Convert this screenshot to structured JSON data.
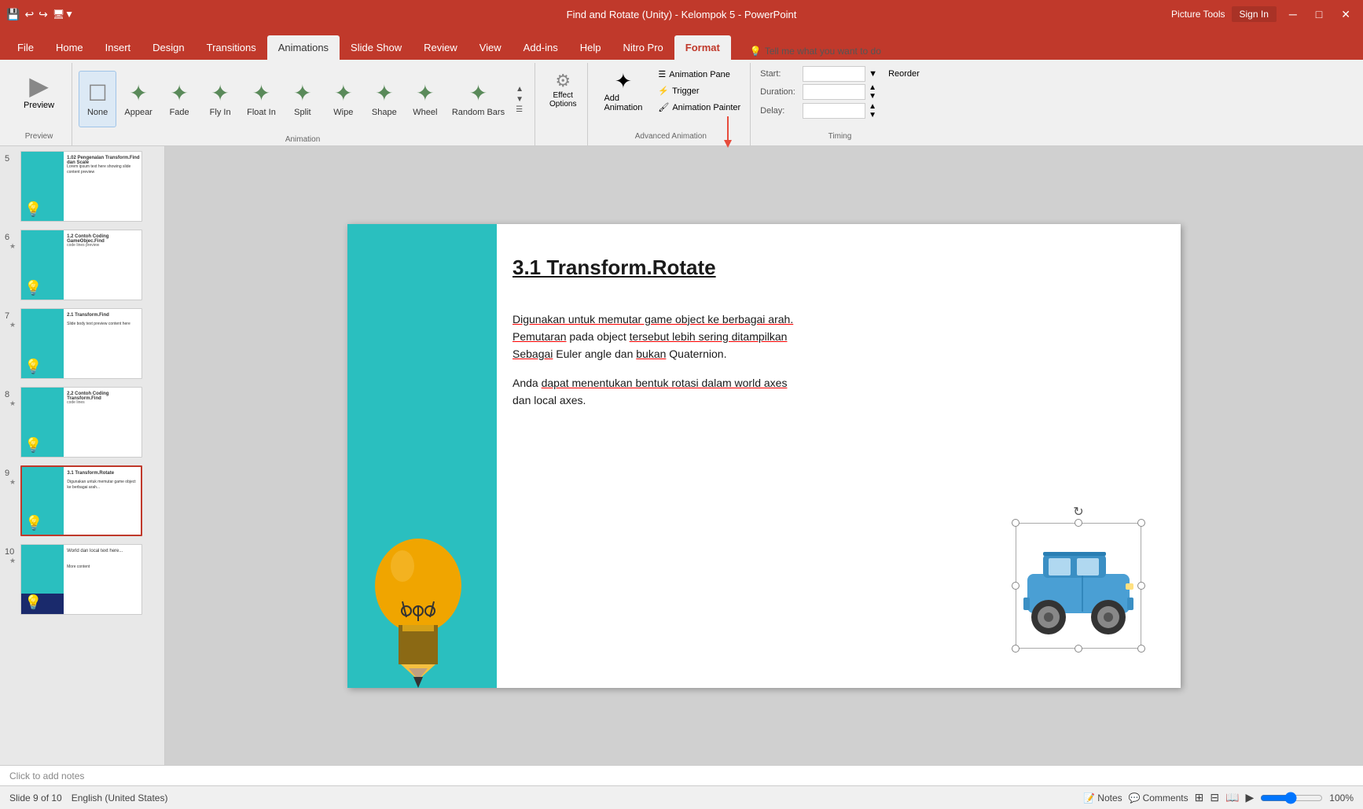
{
  "titlebar": {
    "title": "Find and Rotate (Unity) - Kelompok 5  -  PowerPoint",
    "picture_tools_label": "Picture Tools",
    "sign_in": "Sign In"
  },
  "ribbon_tabs": [
    {
      "label": "File",
      "active": false
    },
    {
      "label": "Home",
      "active": false
    },
    {
      "label": "Insert",
      "active": false
    },
    {
      "label": "Design",
      "active": false
    },
    {
      "label": "Transitions",
      "active": false
    },
    {
      "label": "Animations",
      "active": true
    },
    {
      "label": "Slide Show",
      "active": false
    },
    {
      "label": "Review",
      "active": false
    },
    {
      "label": "View",
      "active": false
    },
    {
      "label": "Add-ins",
      "active": false
    },
    {
      "label": "Help",
      "active": false
    },
    {
      "label": "Nitro Pro",
      "active": false
    },
    {
      "label": "Format",
      "active": false,
      "format": true
    }
  ],
  "ribbon": {
    "preview": {
      "label": "Preview"
    },
    "animations": {
      "label": "Animation",
      "items": [
        {
          "label": "None",
          "active": true
        },
        {
          "label": "Appear"
        },
        {
          "label": "Fade"
        },
        {
          "label": "Fly In"
        },
        {
          "label": "Float In"
        },
        {
          "label": "Split"
        },
        {
          "label": "Wipe"
        },
        {
          "label": "Shape"
        },
        {
          "label": "Wheel"
        },
        {
          "label": "Random Bars"
        }
      ]
    },
    "effect_options": {
      "label": "Effect\nOptions"
    },
    "add_animation": {
      "label": "Add\nAnimation"
    },
    "advanced": {
      "label": "Advanced Animation",
      "animation_pane": "Animation Pane",
      "trigger": "Trigger",
      "animation_painter": "Animation Painter"
    },
    "timing": {
      "label": "Timing",
      "start_label": "Start:",
      "duration_label": "Duration:",
      "delay_label": "Delay:",
      "reorder_label": "Reorder"
    }
  },
  "tell_me": "Tell me what you want to do",
  "slides": [
    {
      "num": "5",
      "star": "",
      "selected": false,
      "label": "Slide 5"
    },
    {
      "num": "6",
      "star": "★",
      "selected": false,
      "label": "Slide 6"
    },
    {
      "num": "7",
      "star": "★",
      "selected": false,
      "label": "Slide 7"
    },
    {
      "num": "8",
      "star": "★",
      "selected": false,
      "label": "Slide 8"
    },
    {
      "num": "9",
      "star": "★",
      "selected": true,
      "label": "Slide 9"
    },
    {
      "num": "10",
      "star": "★",
      "selected": false,
      "label": "Slide 10"
    }
  ],
  "slide": {
    "title": "3.1 Transform.Rotate",
    "body1": "Digunakan untuk memutar game object ke berbagai arah. Pemutaran pada object tersebut lebih sering ditampilkan Sebagai Euler angle dan bukan Quaternion.",
    "body2": "Anda dapat menentukan bentuk rotasi dalam world axes dan local axes.",
    "lightbulb": "💡"
  },
  "notes_placeholder": "Click to add notes",
  "statusbar": {
    "slide_info": "Slide 9 of 10",
    "language": "English (United States)",
    "notes": "Notes",
    "comments": "Comments"
  }
}
